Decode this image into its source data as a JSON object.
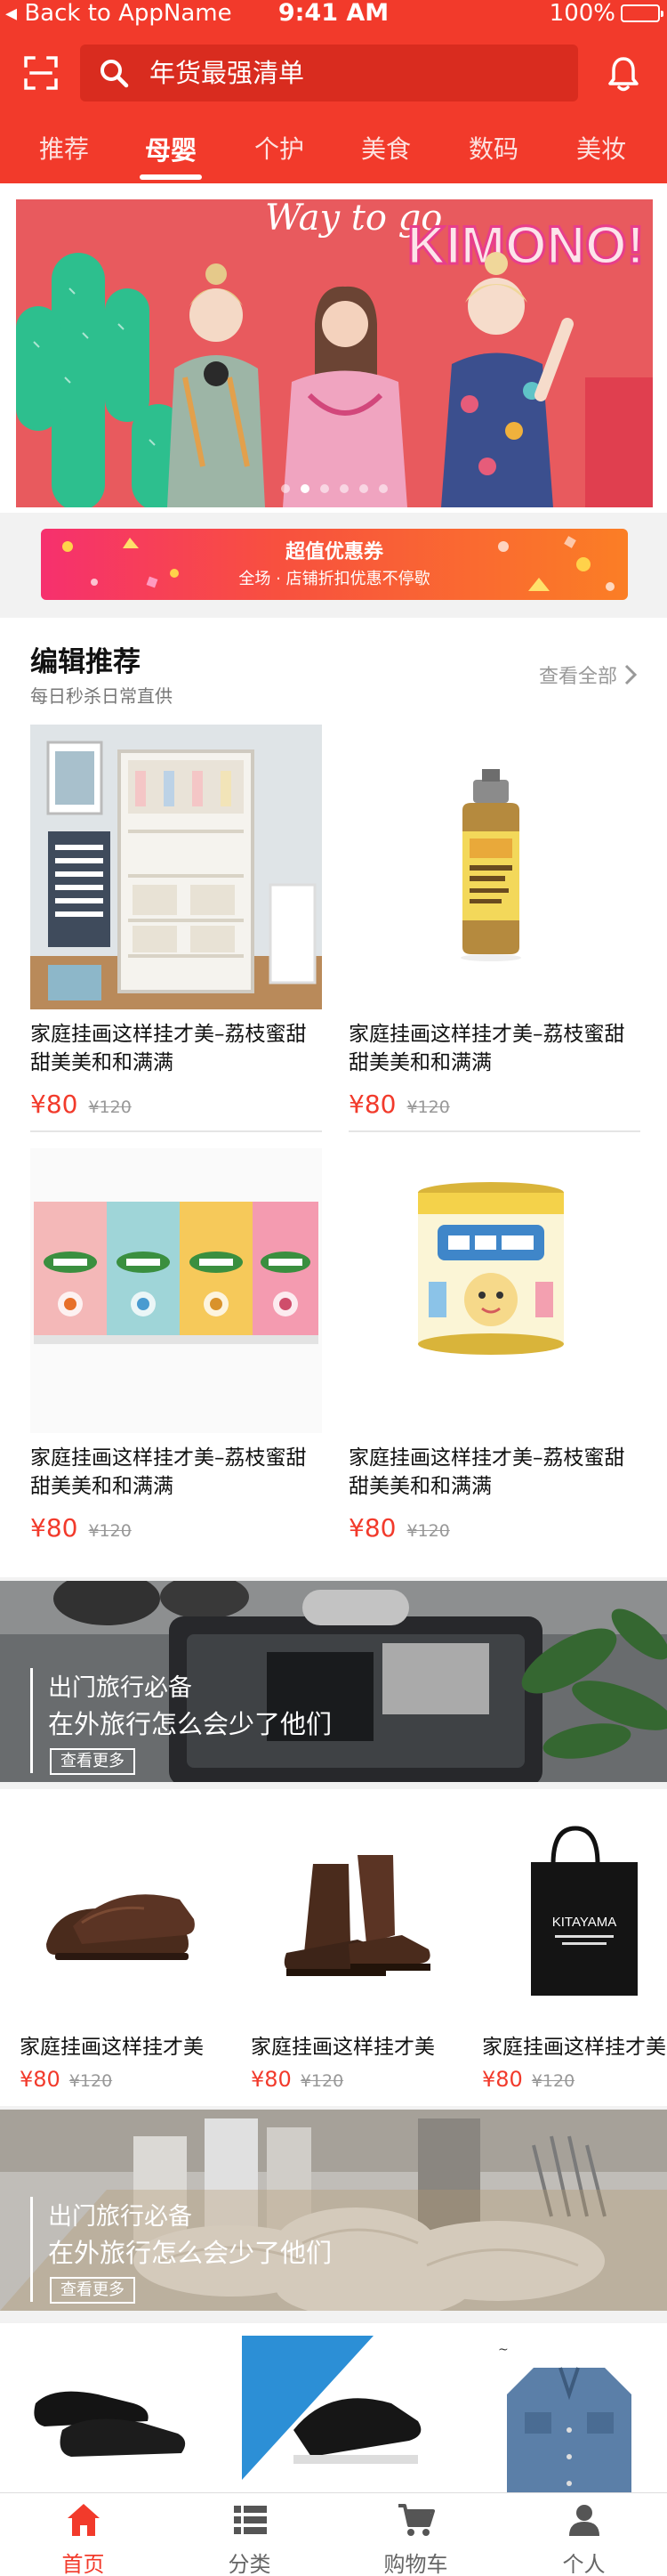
{
  "status_bar": {
    "back": "Back to AppName",
    "time": "9:41 AM",
    "battery": "100%",
    "battery_level": 1.0
  },
  "search": {
    "placeholder": "年货最强清单"
  },
  "tabs": [
    {
      "label": "推荐"
    },
    {
      "label": "母婴"
    },
    {
      "label": "个护"
    },
    {
      "label": "美食"
    },
    {
      "label": "数码"
    },
    {
      "label": "美妆"
    }
  ],
  "active_tab": "母婴",
  "banner": {
    "headline": "KIMONO!",
    "script": "Way to go",
    "slides": 6,
    "active_slide": 1
  },
  "promo": {
    "title": "超值优惠券",
    "subtitle": "全场 · 店铺折扣优惠不停歇"
  },
  "picks": {
    "title": "编辑推荐",
    "subtitle": "每日秒杀日常直供",
    "see_all": "查看全部",
    "products": [
      {
        "name": "家庭挂画这样挂才美–荔枝蜜甜甜美美和和满满",
        "price": "¥80",
        "old_price": "¥120",
        "image": "nursery-room"
      },
      {
        "name": "家庭挂画这样挂才美–荔枝蜜甜甜美美和和满满",
        "price": "¥80",
        "old_price": "¥120",
        "image": "baby-shampoo-bottle"
      },
      {
        "name": "家庭挂画这样挂才美–荔枝蜜甜甜美美和和满满",
        "price": "¥80",
        "old_price": "¥120",
        "image": "organix-snack-boxes"
      },
      {
        "name": "家庭挂画这样挂才美–荔枝蜜甜甜美美和和满满",
        "price": "¥80",
        "old_price": "¥120",
        "image": "milk-formula-can"
      }
    ]
  },
  "feature1": {
    "small": "出门旅行必备",
    "big": "在外旅行怎么会少了他们",
    "button": "查看更多"
  },
  "shoes": [
    {
      "name": "家庭挂画这样挂才美",
      "price": "¥80",
      "old_price": "¥120",
      "image": "brown-oxford-shoes"
    },
    {
      "name": "家庭挂画这样挂才美",
      "price": "¥80",
      "old_price": "¥120",
      "image": "brown-boots"
    },
    {
      "name": "家庭挂画这样挂才美",
      "price": "¥80",
      "old_price": "¥120",
      "image": "kitayama-tote-bag"
    }
  ],
  "kitayama_label": "KITAYAMA",
  "feature2": {
    "small": "出门旅行必备",
    "big": "在外旅行怎么会少了他们",
    "button": "查看更多"
  },
  "tabbar": [
    {
      "label": "首页",
      "icon": "home-icon"
    },
    {
      "label": "分类",
      "icon": "list-icon"
    },
    {
      "label": "购物车",
      "icon": "cart-icon"
    },
    {
      "label": "个人",
      "icon": "user-icon"
    }
  ],
  "colors": {
    "brand": "#f23a2b",
    "search_bg": "#d92c1f",
    "price": "#f23a2b"
  }
}
